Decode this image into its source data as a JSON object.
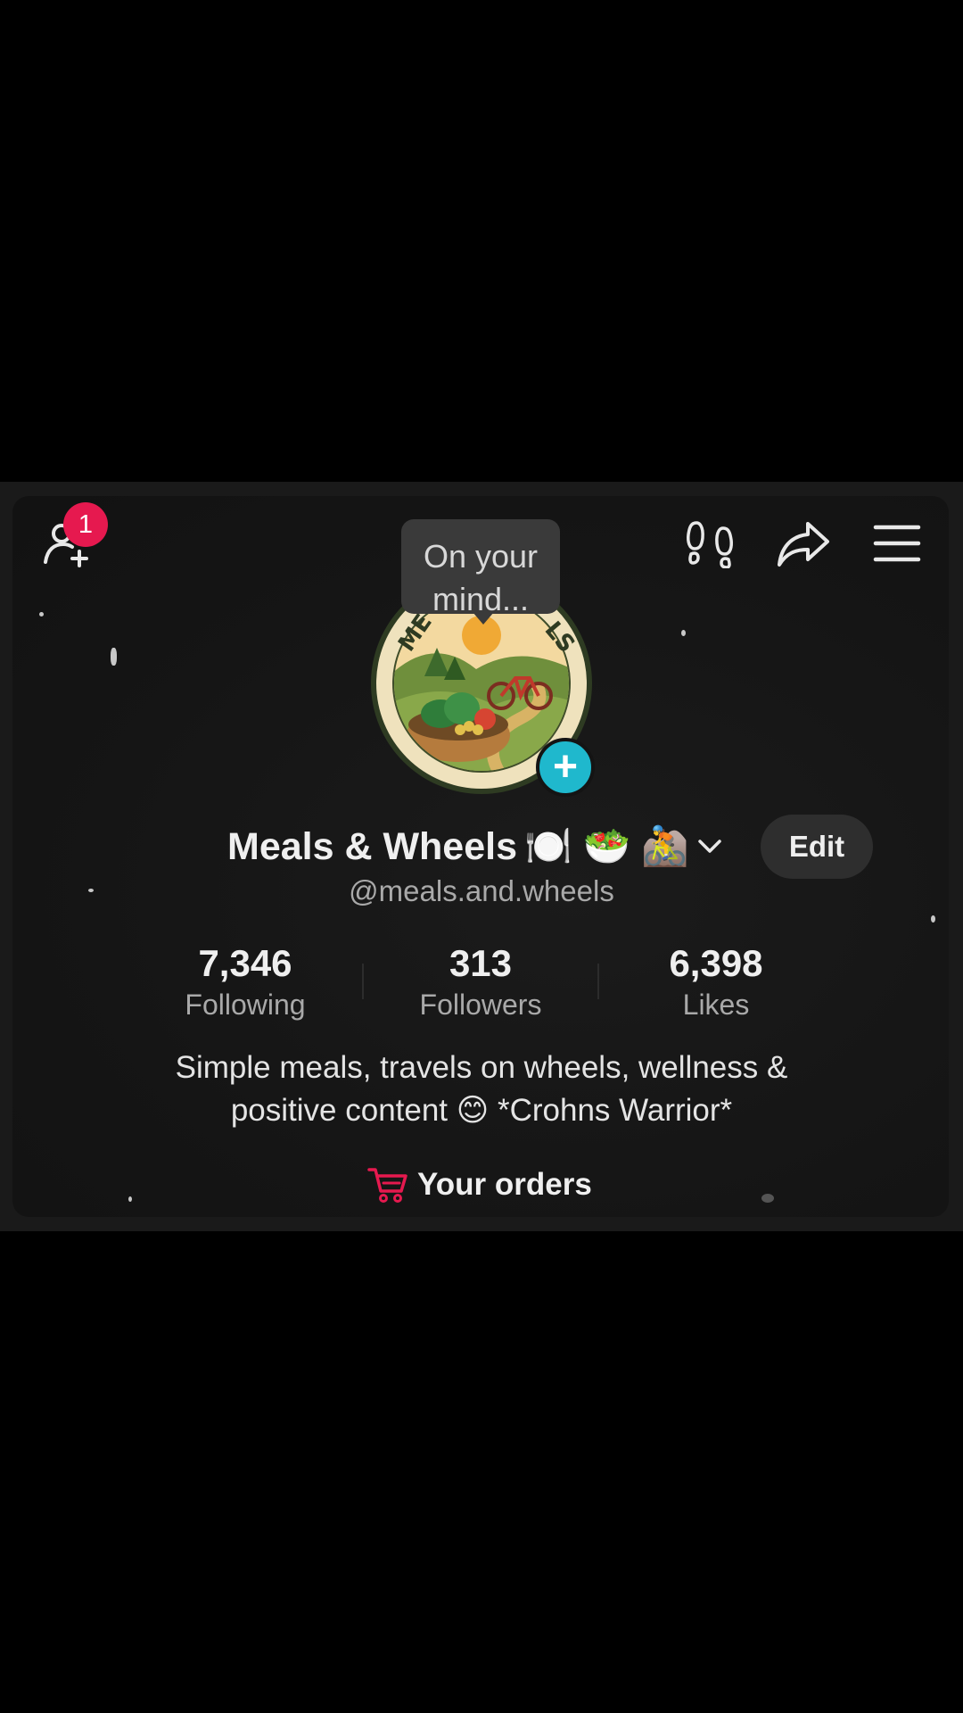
{
  "header": {
    "add_friends_icon": "person-add-icon",
    "notification_count": "1",
    "footprints_icon": "footprints-icon",
    "share_icon": "share-arrow-icon",
    "menu_icon": "hamburger-menu-icon"
  },
  "tooltip": {
    "text": "On your\nmind..."
  },
  "profile": {
    "avatar_icon": "meals-and-wheels-logo",
    "add_story_label": "+",
    "display_name": "Meals & Wheels",
    "name_emojis": "🍽️ 🥗 🚵",
    "dropdown_icon": "chevron-down-icon",
    "edit_label": "Edit",
    "username": "@meals.and.wheels"
  },
  "stats": [
    {
      "value": "7,346",
      "label": "Following"
    },
    {
      "value": "313",
      "label": "Followers"
    },
    {
      "value": "6,398",
      "label": "Likes"
    }
  ],
  "bio": {
    "line1": "Simple meals, travels on wheels, wellness &",
    "line2": "positive content 😊 *Crohns Warrior*"
  },
  "orders": {
    "icon": "shopping-cart-icon",
    "label": "Your orders"
  },
  "colors": {
    "badge": "#e6194f",
    "add_story": "#1fb8cd",
    "cart": "#e6194f"
  }
}
